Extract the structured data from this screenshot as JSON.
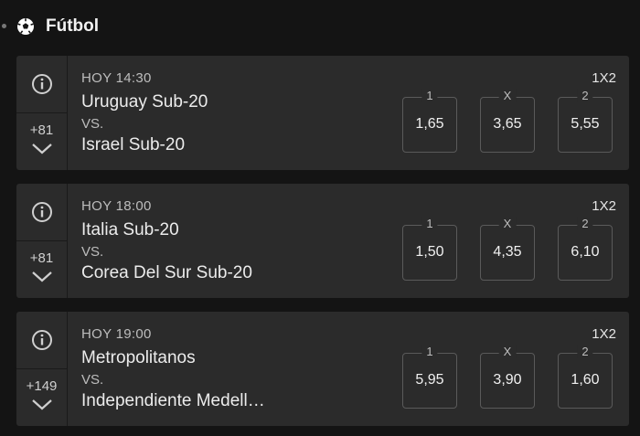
{
  "header": {
    "title": "Fútbol",
    "icon": "soccer-ball-icon"
  },
  "matches": [
    {
      "time": "HOY 14:30",
      "team1": "Uruguay Sub-20",
      "vs": "VS.",
      "team2": "Israel Sub-20",
      "more_markets": "+81",
      "market": "1X2",
      "odds": [
        {
          "label": "1",
          "value": "1,65"
        },
        {
          "label": "X",
          "value": "3,65"
        },
        {
          "label": "2",
          "value": "5,55"
        }
      ]
    },
    {
      "time": "HOY 18:00",
      "team1": "Italia Sub-20",
      "vs": "VS.",
      "team2": "Corea Del Sur Sub-20",
      "more_markets": "+81",
      "market": "1X2",
      "odds": [
        {
          "label": "1",
          "value": "1,50"
        },
        {
          "label": "X",
          "value": "4,35"
        },
        {
          "label": "2",
          "value": "6,10"
        }
      ]
    },
    {
      "time": "HOY 19:00",
      "team1": "Metropolitanos",
      "vs": "VS.",
      "team2": "Independiente Medell…",
      "more_markets": "+149",
      "market": "1X2",
      "odds": [
        {
          "label": "1",
          "value": "5,95"
        },
        {
          "label": "X",
          "value": "3,90"
        },
        {
          "label": "2",
          "value": "1,60"
        }
      ]
    }
  ]
}
